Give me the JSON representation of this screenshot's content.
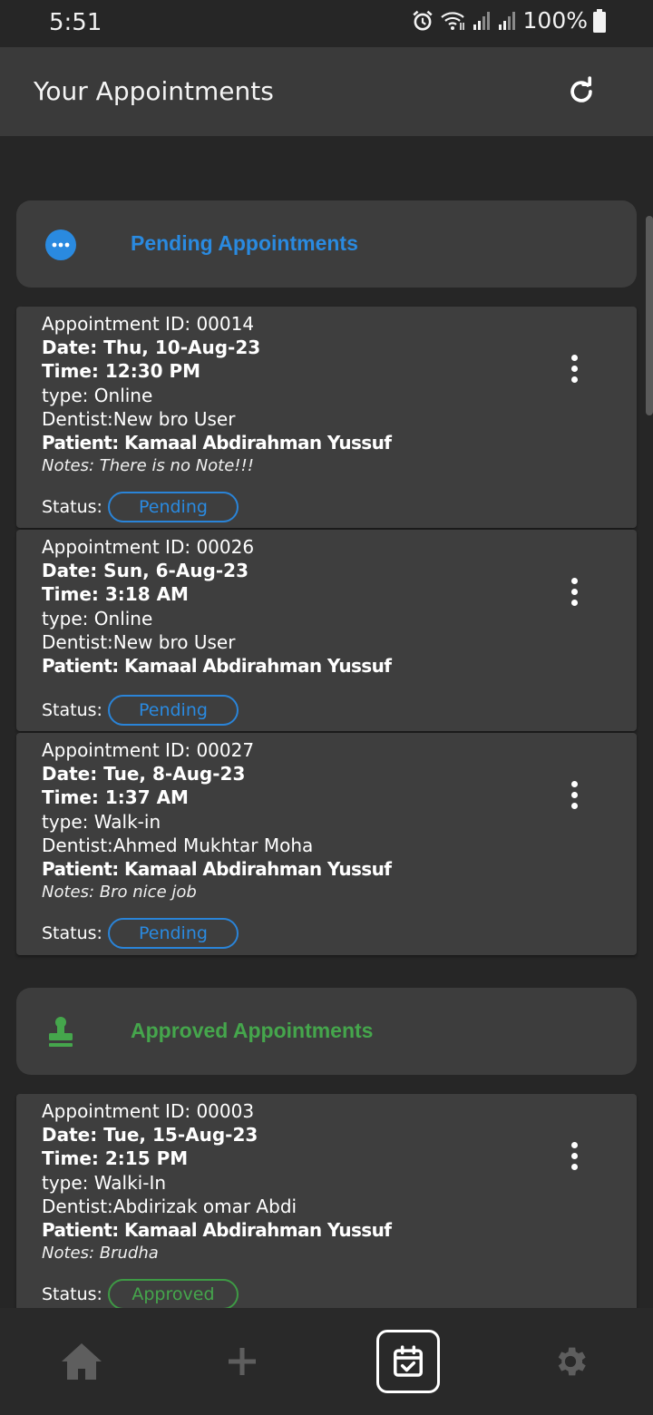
{
  "status_bar": {
    "time": "5:51",
    "battery": "100%"
  },
  "app_bar": {
    "title": "Your Appointments",
    "refresh_icon": "refresh-icon"
  },
  "sections": {
    "pending": {
      "title": "Pending Appointments",
      "icon": "more-horizontal-circle-icon",
      "color": "#2a8ae0"
    },
    "approved": {
      "title": "Approved Appointments",
      "icon": "stamp-icon",
      "color": "#45a64c"
    }
  },
  "status_label": "Status:",
  "appointments": [
    {
      "id_line": "Appointment ID: 00014",
      "date_line": "Date: Thu, 10-Aug-23",
      "time_line": "Time: 12:30 PM",
      "type_line": "type: Online",
      "dentist_line": "Dentist:New bro User",
      "patient_line": "Patient: Kamaal Abdirahman Yussuf",
      "notes_line": "Notes: There is no Note!!!",
      "status": "Pending"
    },
    {
      "id_line": "Appointment ID: 00026",
      "date_line": "Date: Sun, 6-Aug-23",
      "time_line": "Time: 3:18 AM",
      "type_line": "type: Online",
      "dentist_line": "Dentist:New bro User",
      "patient_line": "Patient: Kamaal Abdirahman Yussuf",
      "status": "Pending"
    },
    {
      "id_line": "Appointment ID: 00027",
      "date_line": "Date: Tue, 8-Aug-23",
      "time_line": "Time: 1:37 AM",
      "type_line": "type: Walk-in",
      "dentist_line": "Dentist:Ahmed Mukhtar Moha",
      "patient_line": "Patient: Kamaal Abdirahman Yussuf",
      "notes_line": "Notes: Bro nice job",
      "status": "Pending"
    },
    {
      "id_line": "Appointment ID: 00003",
      "date_line": "Date: Tue, 15-Aug-23",
      "time_line": "Time: 2:15 PM",
      "type_line": "type: Walki-In",
      "dentist_line": "Dentist:Abdirizak omar Abdi",
      "patient_line": "Patient: Kamaal Abdirahman Yussuf",
      "notes_line": "Notes: Brudha",
      "status": "Approved"
    }
  ],
  "bottom_nav": [
    "home-icon",
    "add-icon",
    "calendar-check-icon",
    "settings-icon"
  ]
}
